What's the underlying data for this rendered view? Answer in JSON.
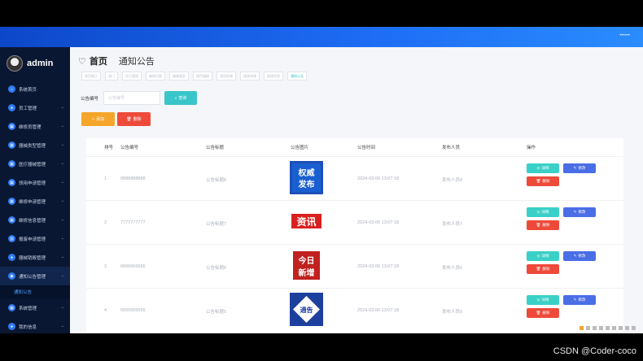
{
  "header": {
    "user": "••••••"
  },
  "sidebar": {
    "username": "admin",
    "items": [
      {
        "label": "系统首页",
        "icon": "home-icon",
        "glyph": "⌂"
      },
      {
        "label": "员工管理",
        "icon": "user-icon",
        "glyph": "●"
      },
      {
        "label": "维修员管理",
        "icon": "grid-icon",
        "glyph": "▦"
      },
      {
        "label": "器械类型管理",
        "icon": "grid-icon",
        "glyph": "▦"
      },
      {
        "label": "医疗器械管理",
        "icon": "grid-icon",
        "glyph": "▦"
      },
      {
        "label": "领用申请管理",
        "icon": "grid-icon",
        "glyph": "▦"
      },
      {
        "label": "维修申请管理",
        "icon": "grid-icon",
        "glyph": "▦"
      },
      {
        "label": "维修信息管理",
        "icon": "grid-icon",
        "glyph": "▦"
      },
      {
        "label": "报废申请管理",
        "icon": "chart-icon",
        "glyph": "▥"
      },
      {
        "label": "器械销毁管理",
        "icon": "user-icon",
        "glyph": "●"
      },
      {
        "label": "通知公告管理",
        "icon": "bell-icon",
        "glyph": "◉"
      },
      {
        "label": "系统管理",
        "icon": "grid-icon",
        "glyph": "▦"
      },
      {
        "label": "我的信息",
        "icon": "user-icon",
        "glyph": "●"
      }
    ],
    "submenu": "通知公告"
  },
  "page": {
    "home": "首页",
    "title": "通知公告",
    "tabs": [
      "首页修正",
      "部门",
      "员工管理",
      "维修员管",
      "器械类型",
      "医疗器械",
      "领用申请",
      "维修申请",
      "维修信息",
      "通知公告"
    ]
  },
  "search": {
    "label": "公告编号",
    "placeholder": "公告编号",
    "button": "查询"
  },
  "actions": {
    "add": "添加",
    "delete": "删除"
  },
  "table": {
    "headers": [
      "排号",
      "公告编号",
      "公告标题",
      "公告图片",
      "公告时间",
      "发布人员",
      "操作"
    ],
    "rows": [
      {
        "index": "1",
        "code": "8888888888",
        "title": "公告标题8",
        "image": "权威发布",
        "time": "2024-03-06 13:07:18",
        "publisher": "发布人员8"
      },
      {
        "index": "2",
        "code": "7777777777",
        "title": "公告标题7",
        "image": "资讯",
        "time": "2024-03-06 13:07:18",
        "publisher": "发布人员7"
      },
      {
        "index": "3",
        "code": "6666666666",
        "title": "公告标题6",
        "image": "今日新增",
        "time": "2024-03-06 13:07:18",
        "publisher": "发布人员6"
      },
      {
        "index": "4",
        "code": "5555555555",
        "title": "公告标题5",
        "image": "通告",
        "time": "2024-03-06 13:07:18",
        "publisher": "发布人员5"
      }
    ],
    "ops": {
      "view": "详情",
      "edit": "修改",
      "delete": "删除"
    }
  },
  "watermark": "CSDN @Coder-coco"
}
